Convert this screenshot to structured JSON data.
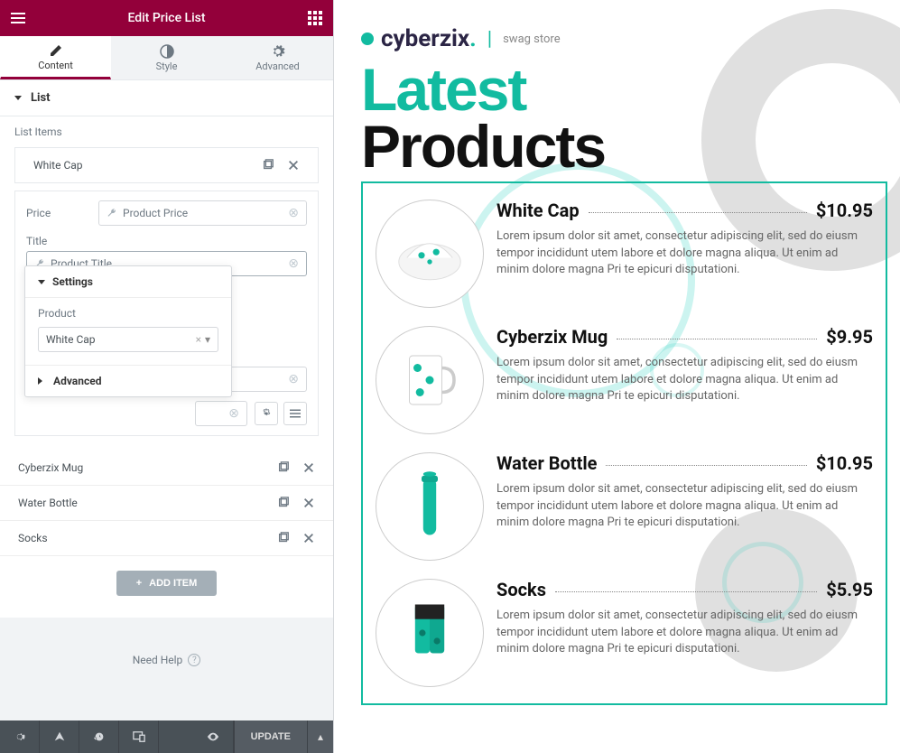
{
  "panel": {
    "title": "Edit Price List",
    "tabs": {
      "content": "Content",
      "style": "Style",
      "advanced": "Advanced"
    },
    "section": {
      "list": "List",
      "list_items_label": "List Items"
    },
    "items": [
      {
        "label": "White Cap"
      },
      {
        "label": "Cyberzix Mug"
      },
      {
        "label": "Water Bottle"
      },
      {
        "label": "Socks"
      }
    ],
    "form": {
      "price_label": "Price",
      "price_value": "Product Price",
      "title_label": "Title",
      "title_value": "Product Title"
    },
    "popover": {
      "settings_label": "Settings",
      "product_label": "Product",
      "product_value": "White Cap",
      "advanced_label": "Advanced"
    },
    "add_item": "ADD ITEM",
    "help": "Need Help",
    "update": "UPDATE"
  },
  "preview": {
    "brand_name": "cyberzix",
    "brand_dot": ".",
    "brand_sub": "swag store",
    "headline_1": "Latest",
    "headline_2": "Products",
    "lorem": "Lorem ipsum dolor sit amet, consectetur adipiscing elit, sed do eiusm tempor incididunt utem labore et dolore magna aliqua. Ut enim ad minim dolore magna Pri te epicuri disputationi.",
    "products": [
      {
        "title": "White Cap",
        "price": "$10.95"
      },
      {
        "title": "Cyberzix Mug",
        "price": "$9.95"
      },
      {
        "title": "Water Bottle",
        "price": "$10.95"
      },
      {
        "title": "Socks",
        "price": "$5.95"
      }
    ]
  }
}
